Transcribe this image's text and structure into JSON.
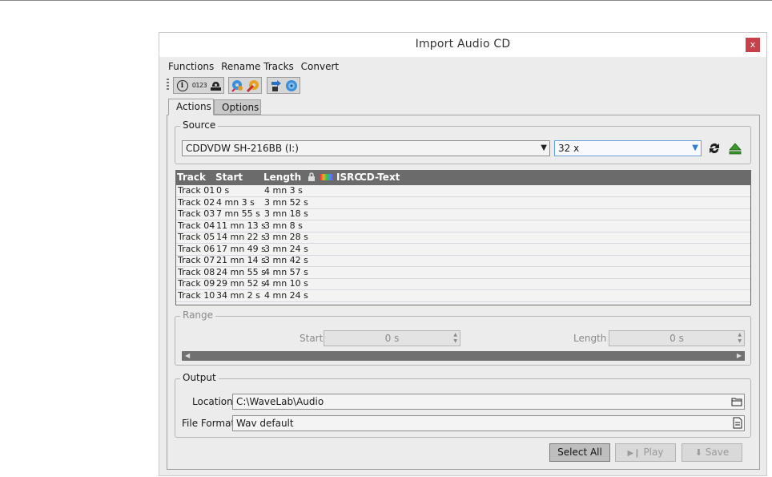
{
  "window": {
    "title": "Import Audio CD",
    "close_glyph": "x"
  },
  "menubar": {
    "items": [
      "Functions",
      "Rename Tracks",
      "Convert"
    ]
  },
  "toolbar": {
    "track_numbers_label": "0123",
    "icons": [
      "info-icon",
      "track-numbers-icon",
      "cd-eject-drive-icon",
      "cd-search-icon",
      "cd-tools-icon",
      "import-icon",
      "cd-disc-icon"
    ]
  },
  "tabs": [
    {
      "label": "Actions",
      "active": true
    },
    {
      "label": "Options",
      "active": false
    }
  ],
  "source": {
    "legend": "Source",
    "drive": "CDDVDW SH-216BB (I:)",
    "speed": "32 x"
  },
  "tracks": {
    "columns": {
      "track": "Track",
      "start": "Start",
      "length": "Length",
      "isrc": "ISRC",
      "cdtext": "CD-Text"
    },
    "rows": [
      {
        "track": "Track 01",
        "start": "0 s",
        "length": "4 mn 3 s"
      },
      {
        "track": "Track 02",
        "start": "4 mn 3 s",
        "length": "3 mn 52 s"
      },
      {
        "track": "Track 03",
        "start": "7 mn 55 s",
        "length": "3 mn 18 s"
      },
      {
        "track": "Track 04",
        "start": "11 mn 13 s",
        "length": "3 mn 8 s"
      },
      {
        "track": "Track 05",
        "start": "14 mn 22 s",
        "length": "3 mn 28 s"
      },
      {
        "track": "Track 06",
        "start": "17 mn 49 s",
        "length": "3 mn 24 s"
      },
      {
        "track": "Track 07",
        "start": "21 mn 14 s",
        "length": "3 mn 42 s"
      },
      {
        "track": "Track 08",
        "start": "24 mn 55 s",
        "length": "4 mn 57 s"
      },
      {
        "track": "Track 09",
        "start": "29 mn 52 s",
        "length": "4 mn 10 s"
      },
      {
        "track": "Track 10",
        "start": "34 mn 2 s",
        "length": "4 mn 24 s"
      }
    ]
  },
  "range": {
    "legend": "Range",
    "start_label": "Start",
    "start_value": "0 s",
    "length_label": "Length",
    "length_value": "0 s"
  },
  "output": {
    "legend": "Output",
    "location_label": "Location",
    "location_value": "C:\\WaveLab\\Audio",
    "format_label": "File Format",
    "format_value": "Wav default"
  },
  "buttons": {
    "select_all": "Select All",
    "play": "Play",
    "save": "Save"
  },
  "colors": {
    "accent": "#2f7fd1",
    "close": "#c8404a",
    "header": "#6b6b6b"
  }
}
